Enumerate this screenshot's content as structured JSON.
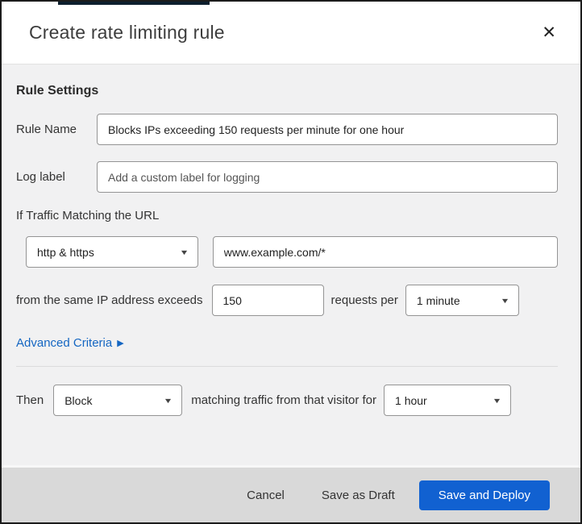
{
  "dialog": {
    "title": "Create rate limiting rule",
    "close_glyph": "✕"
  },
  "rule_settings": {
    "heading": "Rule Settings",
    "rule_name": {
      "label": "Rule Name",
      "value": "Blocks IPs exceeding 150 requests per minute for one hour"
    },
    "log_label": {
      "label": "Log label",
      "placeholder": "Add a custom label for logging"
    }
  },
  "traffic_match": {
    "heading": "If Traffic Matching the URL",
    "scheme_select": {
      "value": "http & https"
    },
    "url_input": {
      "value": "www.example.com/*"
    },
    "threshold": {
      "prefix": "from the same IP address exceeds",
      "requests_value": "150",
      "middle": "requests per",
      "period_select": "1 minute"
    },
    "advanced_link": {
      "label": "Advanced Criteria",
      "arrow": "▶"
    }
  },
  "action": {
    "then_label": "Then",
    "action_select": "Block",
    "middle": "matching traffic from that visitor for",
    "duration_select": "1 hour"
  },
  "footer": {
    "cancel": "Cancel",
    "save_draft": "Save as Draft",
    "save_deploy": "Save and Deploy"
  },
  "icons": {
    "caret_down": "▼"
  },
  "colors": {
    "primary_blue": "#1161d1",
    "link_blue": "#1466c2",
    "top_bar_navy": "#0d1f2e",
    "content_bg": "#f1f1f2",
    "footer_bg": "#d9d9d9"
  }
}
